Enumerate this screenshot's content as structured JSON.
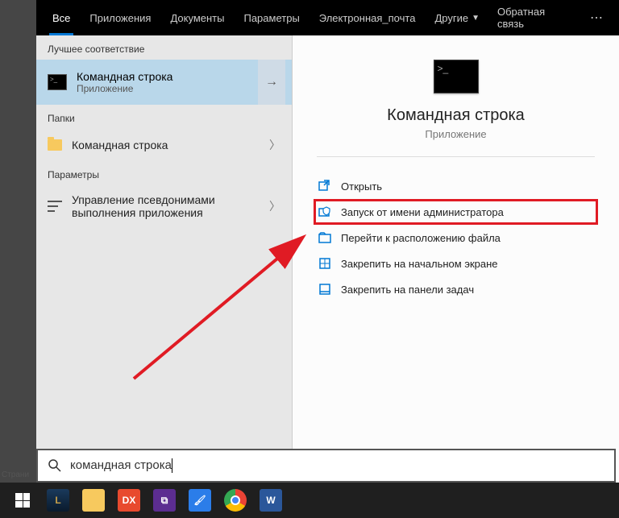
{
  "tabs": {
    "all": "Все",
    "apps": "Приложения",
    "docs": "Документы",
    "settings": "Параметры",
    "email": "Электронная_почта",
    "other": "Другие"
  },
  "feedback": "Обратная связь",
  "sections": {
    "best_match": "Лучшее соответствие",
    "folders": "Папки",
    "settings": "Параметры"
  },
  "best_match": {
    "title": "Командная строка",
    "subtitle": "Приложение"
  },
  "folders_item": "Командная строка",
  "settings_item": "Управление псевдонимами выполнения приложения",
  "details": {
    "title": "Командная строка",
    "subtitle": "Приложение"
  },
  "actions": {
    "open": "Открыть",
    "run_admin": "Запуск от имени администратора",
    "file_location": "Перейти к расположению файла",
    "pin_start": "Закрепить на начальном экране",
    "pin_taskbar": "Закрепить на панели задач"
  },
  "search_query": "командная строка",
  "side_label": "Страни"
}
